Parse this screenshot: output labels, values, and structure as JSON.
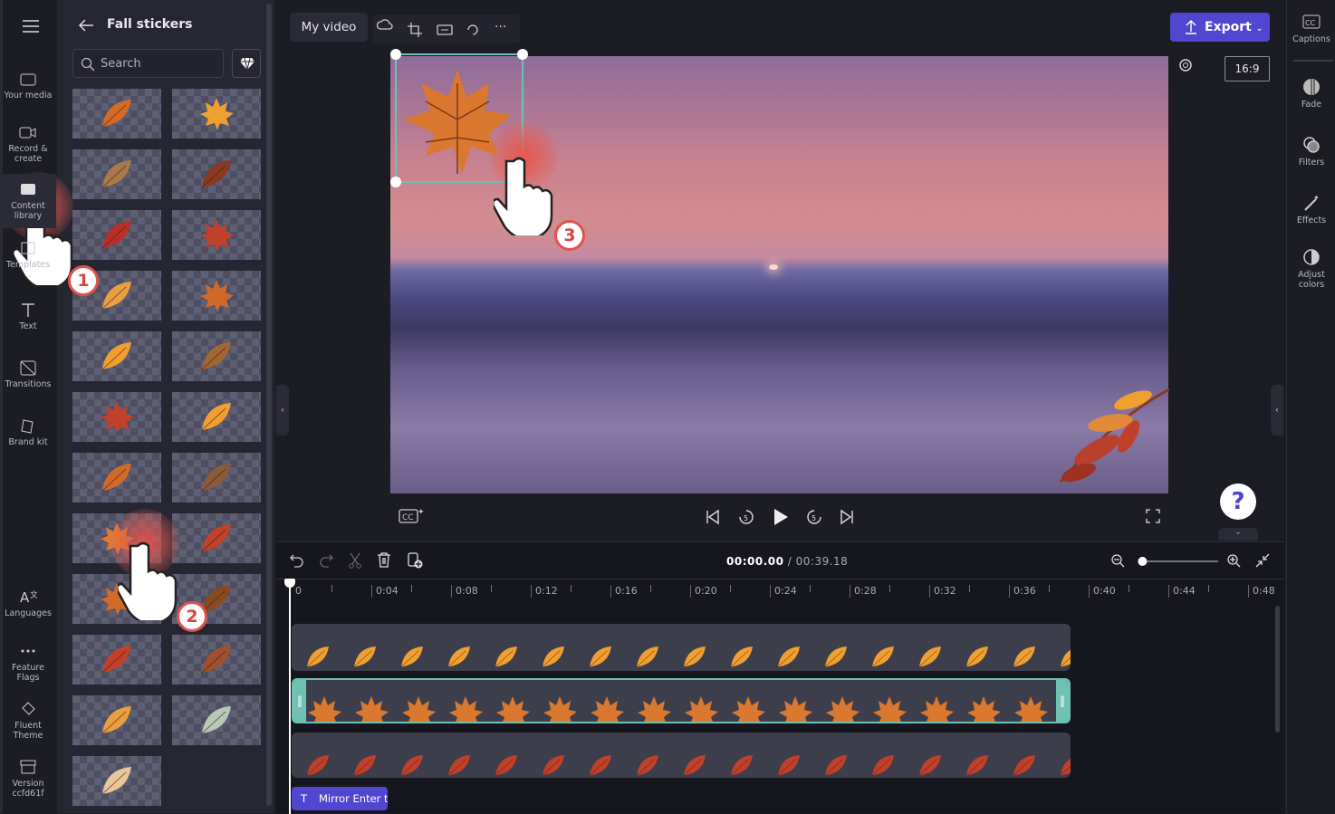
{
  "left_rail": {
    "items": [
      {
        "label": "Your media",
        "icon": "folder-icon"
      },
      {
        "label": "Record & create",
        "icon": "camera-icon"
      },
      {
        "label": "Content library",
        "icon": "library-icon"
      },
      {
        "label": "Templates",
        "icon": "templates-icon"
      },
      {
        "label": "Text",
        "icon": "text-icon"
      },
      {
        "label": "Transitions",
        "icon": "transitions-icon"
      },
      {
        "label": "Brand kit",
        "icon": "brand-kit-icon"
      },
      {
        "label": "Languages",
        "icon": "languages-icon"
      },
      {
        "label": "Feature Flags",
        "icon": "more-icon"
      },
      {
        "label": "Fluent Theme",
        "icon": "paint-bucket-icon"
      },
      {
        "label": "Version ccfd61f",
        "icon": "archive-icon"
      }
    ]
  },
  "panel": {
    "title": "Fall stickers",
    "search_placeholder": "Search",
    "sticker_count": 23
  },
  "topbar": {
    "project_name": "My video",
    "export_label": "Export",
    "aspect_ratio": "16:9"
  },
  "right_rail": {
    "items": [
      {
        "label": "Captions",
        "icon": "cc-icon"
      },
      {
        "label": "Fade",
        "icon": "fade-icon"
      },
      {
        "label": "Filters",
        "icon": "filters-icon"
      },
      {
        "label": "Effects",
        "icon": "magic-wand-icon"
      },
      {
        "label": "Adjust colors",
        "icon": "contrast-icon"
      }
    ]
  },
  "timeline": {
    "current_time": "00:00.00",
    "total_time": "/ 00:39.18",
    "ruler": [
      "0",
      "0:04",
      "0:08",
      "0:12",
      "0:16",
      "0:20",
      "0:24",
      "0:28",
      "0:32",
      "0:36",
      "0:40",
      "0:44",
      "0:48"
    ],
    "text_clip": "Mirror Enter t",
    "zoom_level": 0.05
  },
  "annotations": [
    "1",
    "2",
    "3"
  ],
  "colors": {
    "accent": "#5046d0",
    "selection": "#6fc1b3",
    "leaf": "#e08a3a"
  }
}
